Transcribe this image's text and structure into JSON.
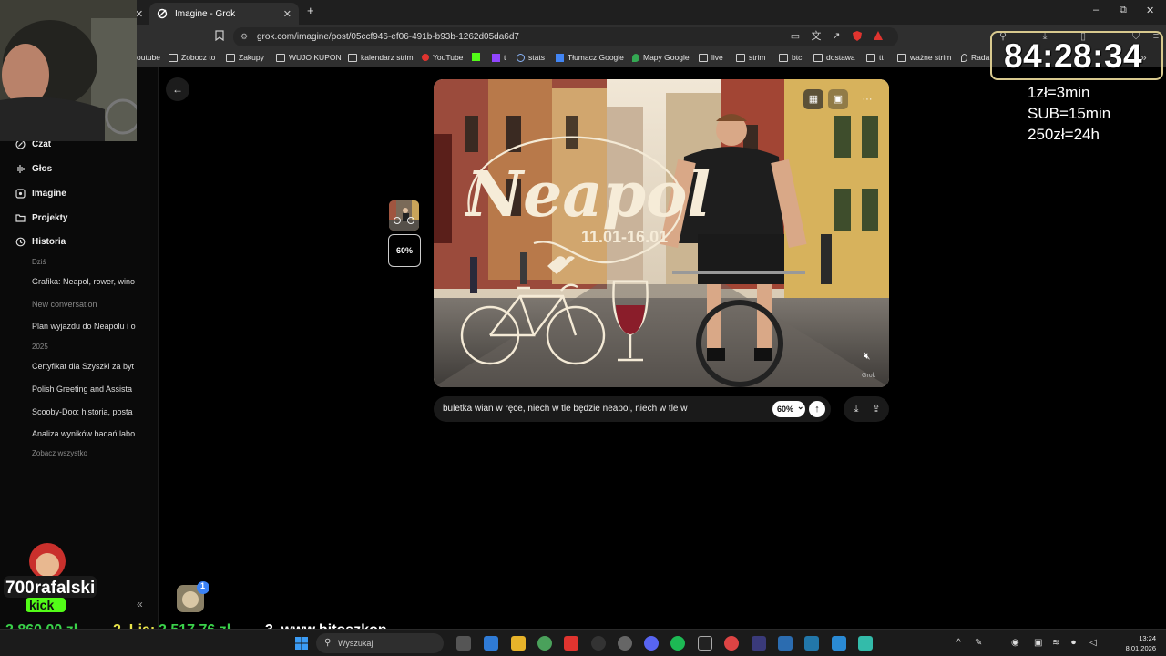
{
  "browser": {
    "tabs": [
      {
        "label": "",
        "active": false
      },
      {
        "label": "Imagine - Grok",
        "active": true
      }
    ],
    "new_tab_label": "+",
    "window_controls": {
      "minimize": "–",
      "restore": "⧉",
      "close": "✕"
    },
    "url": "grok.com/imagine/post/05ccf946-ef06-491b-b93b-1262d05da6d7",
    "bookmarks": [
      {
        "label": "outube",
        "icon": "youtube-icon"
      },
      {
        "label": "Zobocz to",
        "icon": "folder-icon"
      },
      {
        "label": "Zakupy",
        "icon": "folder-icon"
      },
      {
        "label": "WUJO KUPON",
        "icon": "folder-icon"
      },
      {
        "label": "kalendarz strim",
        "icon": "folder-icon"
      },
      {
        "label": "YouTube",
        "icon": "youtube-icon"
      },
      {
        "label": "",
        "icon": "kick-icon"
      },
      {
        "label": "t",
        "icon": "twitch-icon"
      },
      {
        "label": "stats",
        "icon": "stats-icon"
      },
      {
        "label": "Tłumacz Google",
        "icon": "translate-icon"
      },
      {
        "label": "Mapy Google",
        "icon": "maps-icon"
      },
      {
        "label": "live",
        "icon": "folder-icon"
      },
      {
        "label": "strim",
        "icon": "folder-icon"
      },
      {
        "label": "btc",
        "icon": "folder-icon"
      },
      {
        "label": "dostawa",
        "icon": "folder-icon"
      },
      {
        "label": "tt",
        "icon": "folder-icon"
      },
      {
        "label": "ważne strim",
        "icon": "folder-icon"
      },
      {
        "label": "Rada",
        "icon": "drop-icon"
      }
    ],
    "bookmarks_more": "»"
  },
  "sidebar": {
    "nav": [
      {
        "label": "Czat",
        "icon": "chat-icon"
      },
      {
        "label": "Głos",
        "icon": "voice-icon"
      },
      {
        "label": "Imagine",
        "icon": "imagine-icon"
      },
      {
        "label": "Projekty",
        "icon": "folder-icon"
      },
      {
        "label": "Historia",
        "icon": "history-icon"
      }
    ],
    "groups": {
      "today": "Dziś",
      "year": "2025"
    },
    "history_today": [
      {
        "label": "Grafika: Neapol, rower, wino",
        "dim": false
      },
      {
        "label": "New conversation",
        "dim": true
      },
      {
        "label": "Plan wyjazdu do Neapolu i o",
        "dim": false
      }
    ],
    "history_2025": [
      "Certyfikat dla Szyszki za byt",
      "Polish Greeting and Assista",
      "Scooby-Doo: historia, posta",
      "Analiza wyników badań labo"
    ],
    "see_all": "Zobacz wszystko",
    "collapse_icon": "«"
  },
  "main": {
    "back_icon": "←",
    "thumb_percent": "60%",
    "image": {
      "title": "Neapol",
      "dates": "11.01-16.01",
      "watermark": "Grok"
    },
    "prompt": {
      "text": "buletka wian w ręce, niech w tle będzie neapol, niech w tle w",
      "percent": "60%",
      "dropdown_icon": "⌄",
      "send_icon": "↑"
    }
  },
  "overlay": {
    "timer": "84:28:34",
    "rates": [
      "1zł=3min",
      "SUB=15min",
      "250zł=24h"
    ],
    "streamer": "700rafalski",
    "platform": "kick",
    "avatar_badge": "1",
    "ticker": [
      {
        "text": "2 860,00 zł",
        "color": "#3ad14a"
      },
      {
        "text": "2. Lia:",
        "color": "#e7e24a"
      },
      {
        "text": "2 517,76 zł",
        "color": "#3ad14a"
      },
      {
        "text": "3. www.hitoszkon",
        "color": "#ffffff"
      }
    ]
  },
  "taskbar": {
    "search_placeholder": "Wyszukaj",
    "time": "13:24",
    "date": "8.01.2026"
  },
  "colors": {
    "timer_border": "#d8c98e",
    "accent_red": "#e0342f",
    "kick_green": "#53fc18"
  }
}
